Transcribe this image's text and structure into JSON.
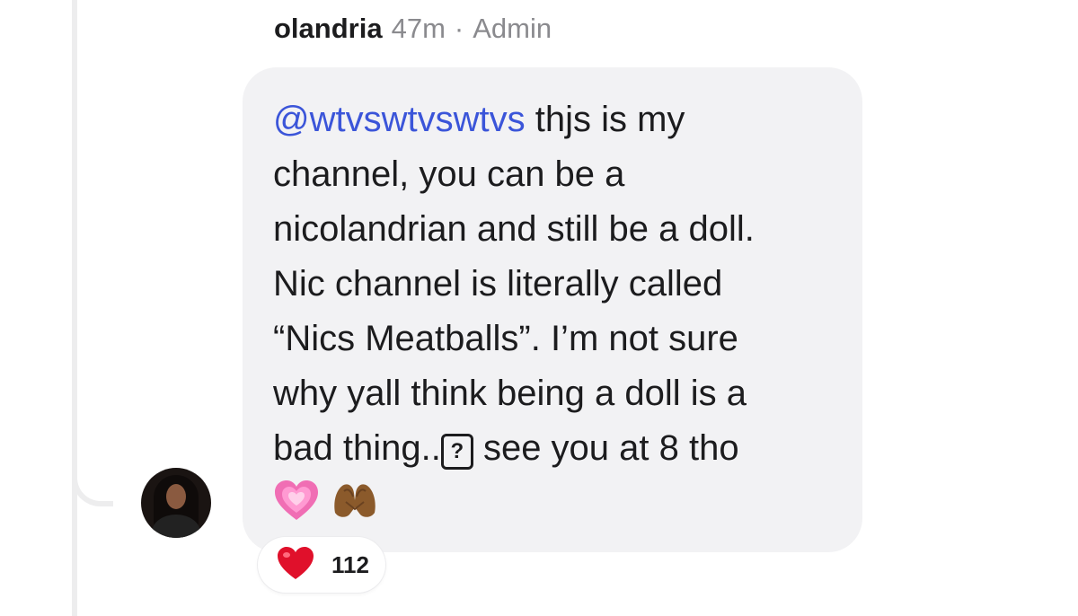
{
  "comment": {
    "author": "olandria",
    "time": "47m",
    "separator": "·",
    "role": "Admin",
    "mention": "@wtvswtvswtvs",
    "line1_rest": " thjs is my",
    "line2": "channel, you can be a",
    "line3": "nicolandrian and still be a doll.",
    "line4": "Nic channel is literally called",
    "line5": "“Nics Meatballs”. I’m not sure",
    "line6": "why yall think being a doll is a",
    "line7_a": "bad thing..",
    "unknown_glyph": "?",
    "line7_b": " see you at 8 tho",
    "emojis": [
      "growing-heart-emoji",
      "heart-hands-emoji"
    ]
  },
  "reaction": {
    "icon": "red-heart-icon",
    "count": "112"
  },
  "colors": {
    "mention": "#3b55d9",
    "bubble": "#f2f2f4",
    "heart": "#e0102b",
    "meta": "#8a8a8e"
  }
}
